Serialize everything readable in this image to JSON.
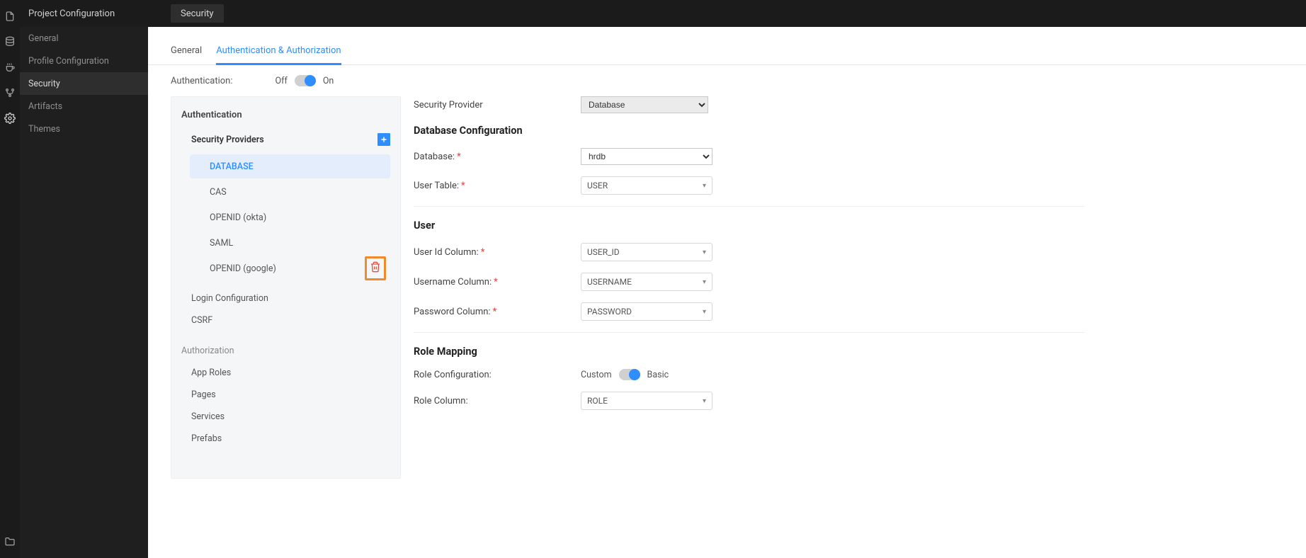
{
  "rail": {
    "icons": [
      "file-icon",
      "database-icon",
      "cup-icon",
      "branch-icon",
      "gear-icon",
      "folder-icon"
    ]
  },
  "sidebar": {
    "title": "Project Configuration",
    "items": [
      {
        "label": "General"
      },
      {
        "label": "Profile Configuration"
      },
      {
        "label": "Security"
      },
      {
        "label": "Artifacts"
      },
      {
        "label": "Themes"
      }
    ]
  },
  "topbar": {
    "tab": "Security"
  },
  "tabs": [
    {
      "label": "General"
    },
    {
      "label": "Authentication & Authorization"
    }
  ],
  "auth_toggle": {
    "label": "Authentication:",
    "off": "Off",
    "on": "On"
  },
  "left_panel": {
    "heading": "Authentication",
    "providers_heading": "Security Providers",
    "providers": [
      {
        "label": "DATABASE"
      },
      {
        "label": "CAS"
      },
      {
        "label": "OPENID (okta)"
      },
      {
        "label": "SAML"
      },
      {
        "label": "OPENID (google)"
      }
    ],
    "login_config": "Login Configuration",
    "csrf": "CSRF",
    "authz_heading": "Authorization",
    "authz_items": [
      {
        "label": "App Roles"
      },
      {
        "label": "Pages"
      },
      {
        "label": "Services"
      },
      {
        "label": "Prefabs"
      }
    ]
  },
  "right_panel": {
    "security_provider_label": "Security Provider",
    "security_provider_value": "Database",
    "db_config_title": "Database Configuration",
    "database_label": "Database:",
    "database_value": "hrdb",
    "user_table_label": "User Table:",
    "user_table_value": "USER",
    "user_title": "User",
    "userid_label": "User Id Column:",
    "userid_value": "USER_ID",
    "username_label": "Username Column:",
    "username_value": "USERNAME",
    "password_label": "Password Column:",
    "password_value": "PASSWORD",
    "role_title": "Role Mapping",
    "role_config_label": "Role Configuration:",
    "role_custom": "Custom",
    "role_basic": "Basic",
    "role_column_label": "Role Column:",
    "role_column_value": "ROLE"
  }
}
